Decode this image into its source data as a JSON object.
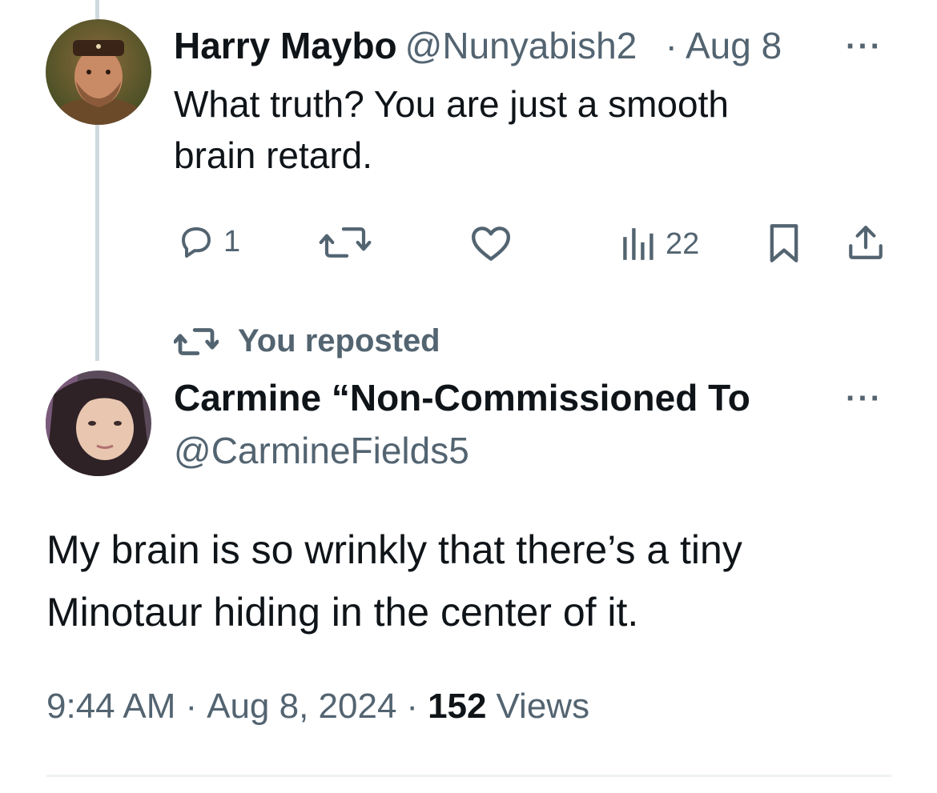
{
  "reply_tweet": {
    "author_name": "Harry Maybo",
    "handle": "@Nunyabish2",
    "separator": "·",
    "date": "Aug 8",
    "more": "···",
    "text_line1": "What truth?  You are just a smooth",
    "text_line2": "brain retard.",
    "actions": {
      "reply_count": "1",
      "repost_count": "",
      "like_count": "",
      "views_count": "22"
    },
    "icons": [
      "reply-icon",
      "repost-icon",
      "like-icon",
      "views-icon",
      "bookmark-icon",
      "share-icon"
    ]
  },
  "repost_banner": {
    "label": "You reposted"
  },
  "main_tweet": {
    "author_name": "Carmine “Non-Commissioned To",
    "handle": "@CarmineFields5",
    "more": "···",
    "text_line1": "My brain is so wrinkly that there’s a tiny",
    "text_line2": "Minotaur hiding in the center of it.",
    "time": "9:44 AM",
    "sep1": "·",
    "date": "Aug 8, 2024",
    "sep2": "·",
    "views_count": "152",
    "views_label": "Views"
  },
  "colors": {
    "text": "#0f1419",
    "muted": "#536471",
    "thread_line": "#cfd9de",
    "divider": "#eff3f4"
  }
}
